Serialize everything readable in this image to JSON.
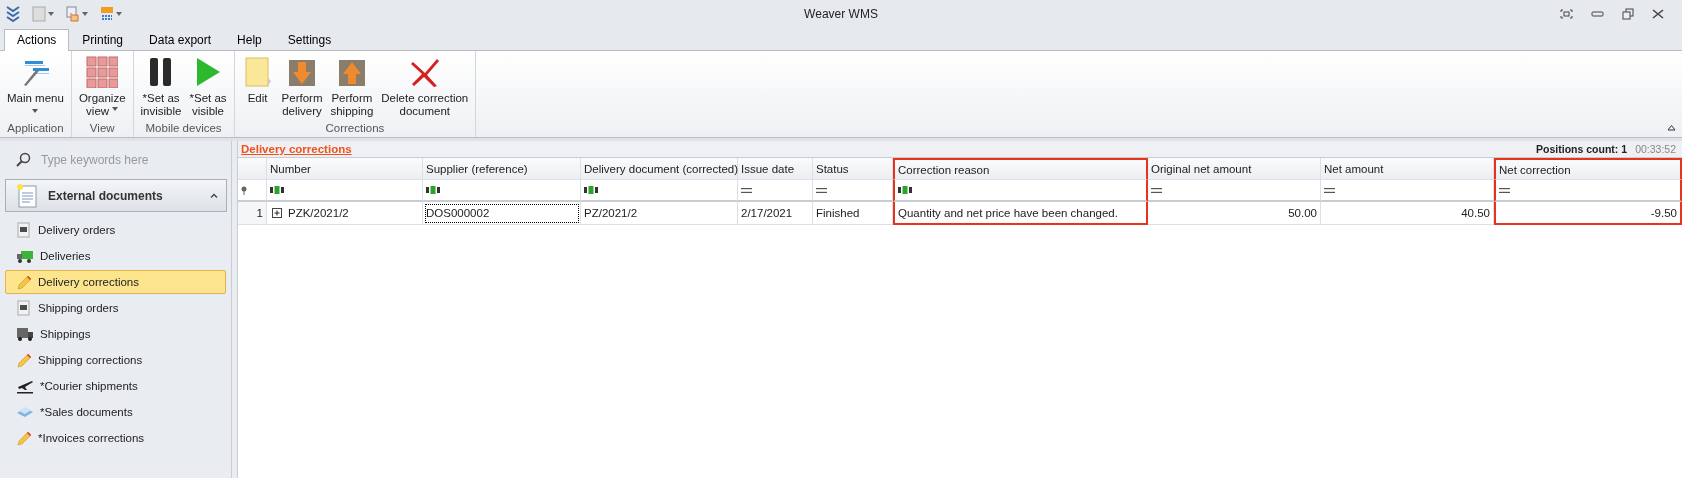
{
  "window": {
    "title": "Weaver WMS"
  },
  "ribbon_tabs": [
    {
      "label": "Actions",
      "selected": true
    },
    {
      "label": "Printing",
      "selected": false
    },
    {
      "label": "Data export",
      "selected": false
    },
    {
      "label": "Help",
      "selected": false
    },
    {
      "label": "Settings",
      "selected": false
    }
  ],
  "ribbon_groups": [
    {
      "label": "Application",
      "buttons": [
        {
          "lines": [
            "Main menu"
          ],
          "kind": "menu",
          "dropdown": true
        }
      ]
    },
    {
      "label": "View",
      "buttons": [
        {
          "lines": [
            "Organize",
            "view"
          ],
          "kind": "grid",
          "dropdown": true
        }
      ]
    },
    {
      "label": "Mobile devices",
      "buttons": [
        {
          "lines": [
            "*Set as",
            "invisible"
          ],
          "kind": "pause",
          "dropdown": false
        },
        {
          "lines": [
            "*Set as",
            "visible"
          ],
          "kind": "play",
          "dropdown": false
        }
      ]
    },
    {
      "label": "Corrections",
      "buttons": [
        {
          "lines": [
            "Edit"
          ],
          "kind": "folder",
          "dropdown": false
        },
        {
          "lines": [
            "Perform",
            "delivery"
          ],
          "kind": "box-down",
          "dropdown": false
        },
        {
          "lines": [
            "Perform",
            "shipping"
          ],
          "kind": "box-up",
          "dropdown": false
        },
        {
          "lines": [
            "Delete correction",
            "document"
          ],
          "kind": "delete",
          "dropdown": false
        }
      ]
    }
  ],
  "sidebar": {
    "search": {
      "placeholder": "Type keywords here"
    },
    "group": {
      "label": "External documents",
      "expanded": true
    },
    "items": [
      {
        "label": "Delivery orders",
        "kind": "truck-doc",
        "selected": false
      },
      {
        "label": "Deliveries",
        "kind": "truck",
        "selected": false
      },
      {
        "label": "Delivery corrections",
        "kind": "pencil",
        "selected": true
      },
      {
        "label": "Shipping orders",
        "kind": "truck-doc",
        "selected": false
      },
      {
        "label": "Shippings",
        "kind": "lorry",
        "selected": false
      },
      {
        "label": "Shipping corrections",
        "kind": "pencil",
        "selected": false
      },
      {
        "label": "*Courier shipments",
        "kind": "plane",
        "selected": false
      },
      {
        "label": "*Sales documents",
        "kind": "papers",
        "selected": false
      },
      {
        "label": "*Invoices corrections",
        "kind": "pencil",
        "selected": false
      }
    ]
  },
  "view": {
    "title": "Delivery corrections",
    "positions_count": "Positions count: 1",
    "time": "00:33:52"
  },
  "table": {
    "columns": [
      {
        "label": "Number",
        "kind": "text",
        "highlighted": false
      },
      {
        "label": "Supplier (reference)",
        "kind": "text",
        "highlighted": false
      },
      {
        "label": "Delivery document (corrected)",
        "kind": "text",
        "highlighted": false
      },
      {
        "label": "Issue date",
        "kind": "plain",
        "highlighted": false
      },
      {
        "label": "Status",
        "kind": "plain",
        "highlighted": false
      },
      {
        "label": "Correction reason",
        "kind": "text",
        "highlighted": true
      },
      {
        "label": "Original net amount",
        "kind": "amount",
        "highlighted": false
      },
      {
        "label": "Net amount",
        "kind": "amount",
        "highlighted": false
      },
      {
        "label": "Net correction",
        "kind": "amount",
        "highlighted": true
      }
    ],
    "rows": [
      {
        "index": "1",
        "expandable": true,
        "cells": [
          {
            "text": "PZK/2021/2",
            "focused": false
          },
          {
            "text": "DOS000002",
            "focused": true
          },
          {
            "text": "PZ/2021/2",
            "focused": false
          },
          {
            "text": "2/17/2021",
            "focused": false
          },
          {
            "text": "Finished",
            "focused": false
          },
          {
            "text": "Quantity and net price have been changed.",
            "focused": false
          },
          {
            "text": "50.00",
            "focused": false
          },
          {
            "text": "40.50",
            "focused": false
          },
          {
            "text": "-9.50",
            "focused": false
          }
        ]
      }
    ]
  }
}
